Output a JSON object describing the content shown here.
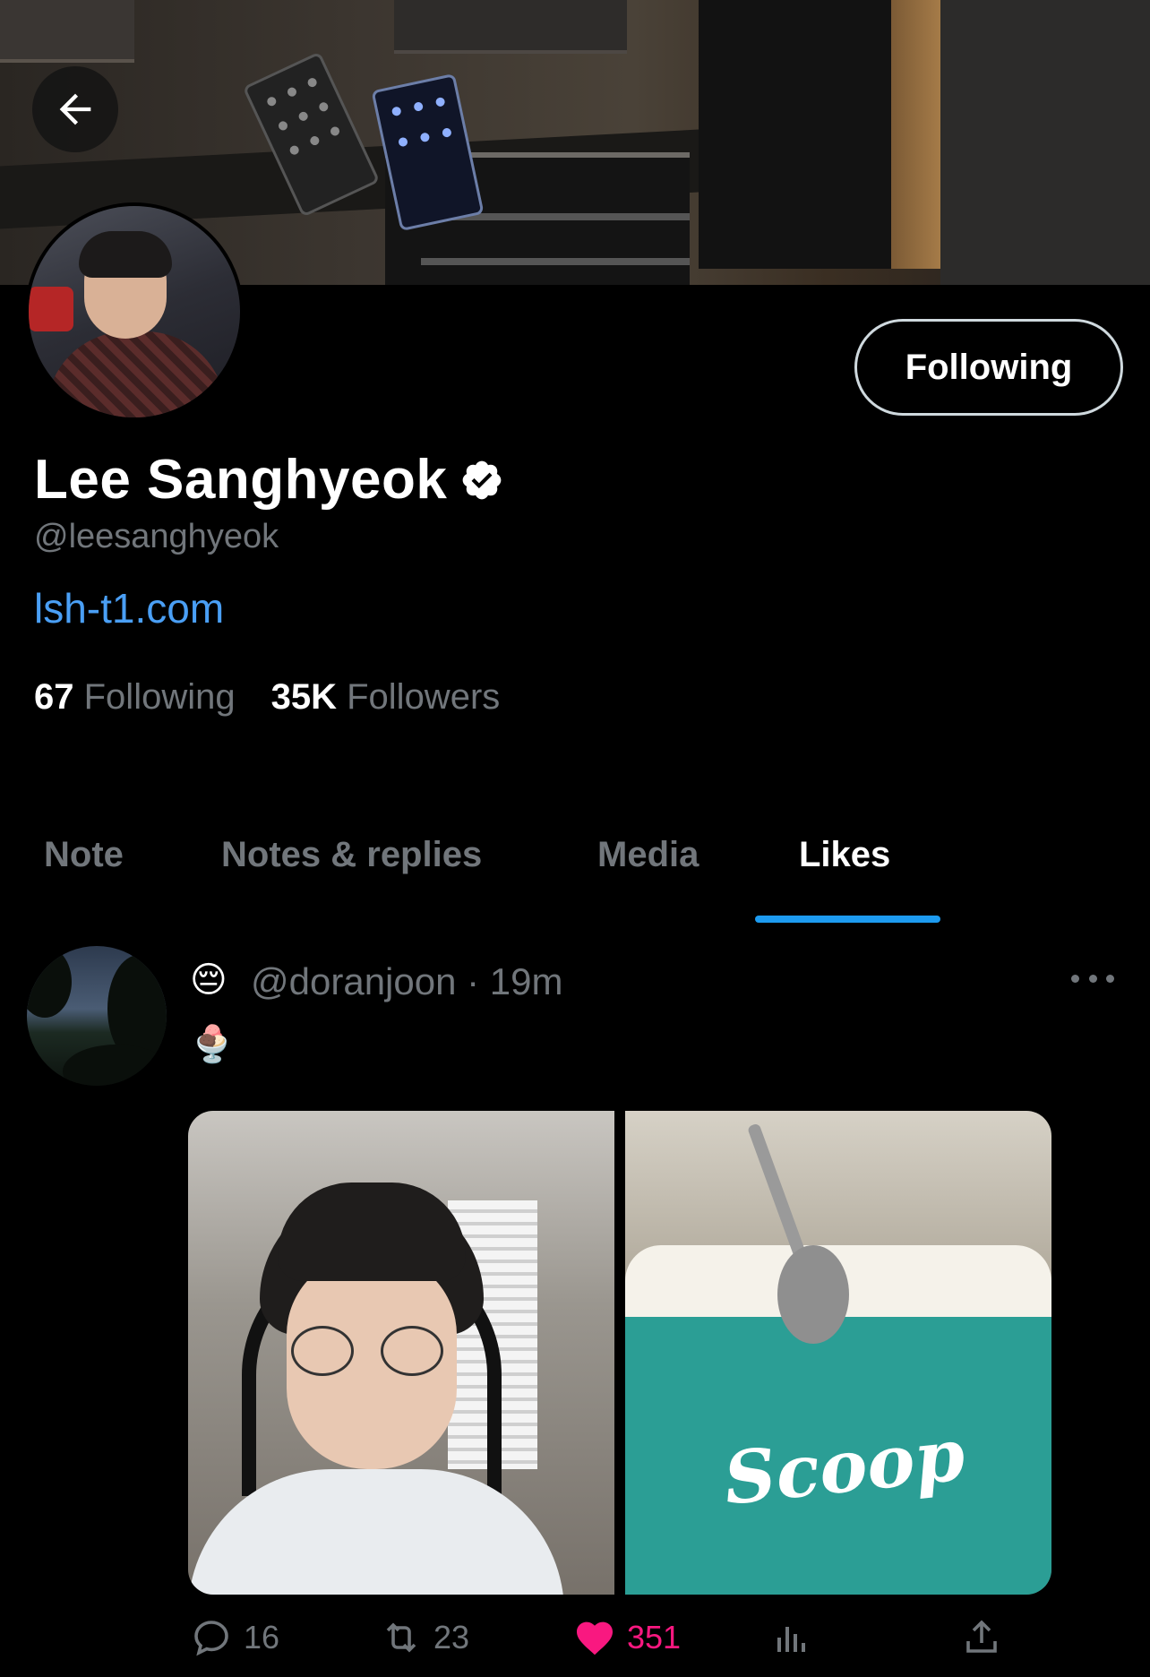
{
  "profile": {
    "display_name": "Lee Sanghyeok",
    "handle": "@leesanghyeok",
    "website": "lsh-t1.com",
    "verified": true,
    "following_count": "67",
    "following_label": "Following",
    "followers_count": "35K",
    "followers_label": "Followers",
    "follow_button_label": "Following"
  },
  "nav": {
    "back_icon": "arrow-left-icon"
  },
  "tabs": [
    {
      "label": "Note",
      "active": false
    },
    {
      "label": "Notes & replies",
      "active": false
    },
    {
      "label": "Media",
      "active": false
    },
    {
      "label": "Likes",
      "active": true
    }
  ],
  "post": {
    "author_emoji": "😔",
    "handle_time": "@doranjoon · 19m",
    "body_emoji": "🍨",
    "media_caption_right": "Scoop",
    "reply_count": "16",
    "repost_count": "23",
    "like_count": "351",
    "liked": true
  },
  "colors": {
    "accent": "#1d9bf0",
    "link": "#4a9ff5",
    "muted": "#71767b",
    "like": "#f91880"
  }
}
